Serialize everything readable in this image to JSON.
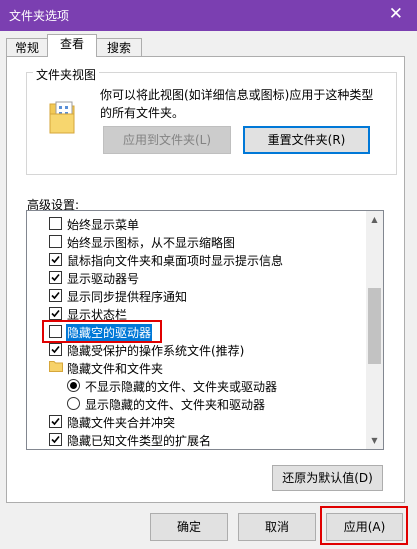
{
  "window": {
    "title": "文件夹选项",
    "close_glyph": "✕"
  },
  "tabs": [
    {
      "label": "常规"
    },
    {
      "label": "查看"
    },
    {
      "label": "搜索"
    }
  ],
  "folder_views": {
    "title": "文件夹视图",
    "description": "你可以将此视图(如详细信息或图标)应用于这种类型的所有文件夹。",
    "apply_button": "应用到文件夹(L)",
    "reset_button": "重置文件夹(R)"
  },
  "advanced": {
    "label": "高级设置:",
    "items": [
      {
        "type": "checkbox",
        "label": "始终显示菜单",
        "checked": false
      },
      {
        "type": "checkbox",
        "label": "始终显示图标，从不显示缩略图",
        "checked": false
      },
      {
        "type": "checkbox",
        "label": "鼠标指向文件夹和桌面项时显示提示信息",
        "checked": true
      },
      {
        "type": "checkbox",
        "label": "显示驱动器号",
        "checked": true
      },
      {
        "type": "checkbox",
        "label": "显示同步提供程序通知",
        "checked": true
      },
      {
        "type": "checkbox",
        "label": "显示状态栏",
        "checked": true
      },
      {
        "type": "checkbox",
        "label": "隐藏空的驱动器",
        "checked": false,
        "selected": true
      },
      {
        "type": "checkbox",
        "label": "隐藏受保护的操作系统文件(推荐)",
        "checked": true
      },
      {
        "type": "folder",
        "label": "隐藏文件和文件夹"
      },
      {
        "type": "radio",
        "label": "不显示隐藏的文件、文件夹或驱动器",
        "checked": true
      },
      {
        "type": "radio",
        "label": "显示隐藏的文件、文件夹和驱动器",
        "checked": false
      },
      {
        "type": "checkbox",
        "label": "隐藏文件夹合并冲突",
        "checked": true
      },
      {
        "type": "checkbox",
        "label": "隐藏已知文件类型的扩展名",
        "checked": true
      }
    ],
    "restore_button": "还原为默认值(D)"
  },
  "footer": {
    "ok": "确定",
    "cancel": "取消",
    "apply": "应用(A)"
  },
  "colors": {
    "titlebar": "#7b3fb1",
    "selection": "#0078d7",
    "highlight_box": "#e00000"
  }
}
